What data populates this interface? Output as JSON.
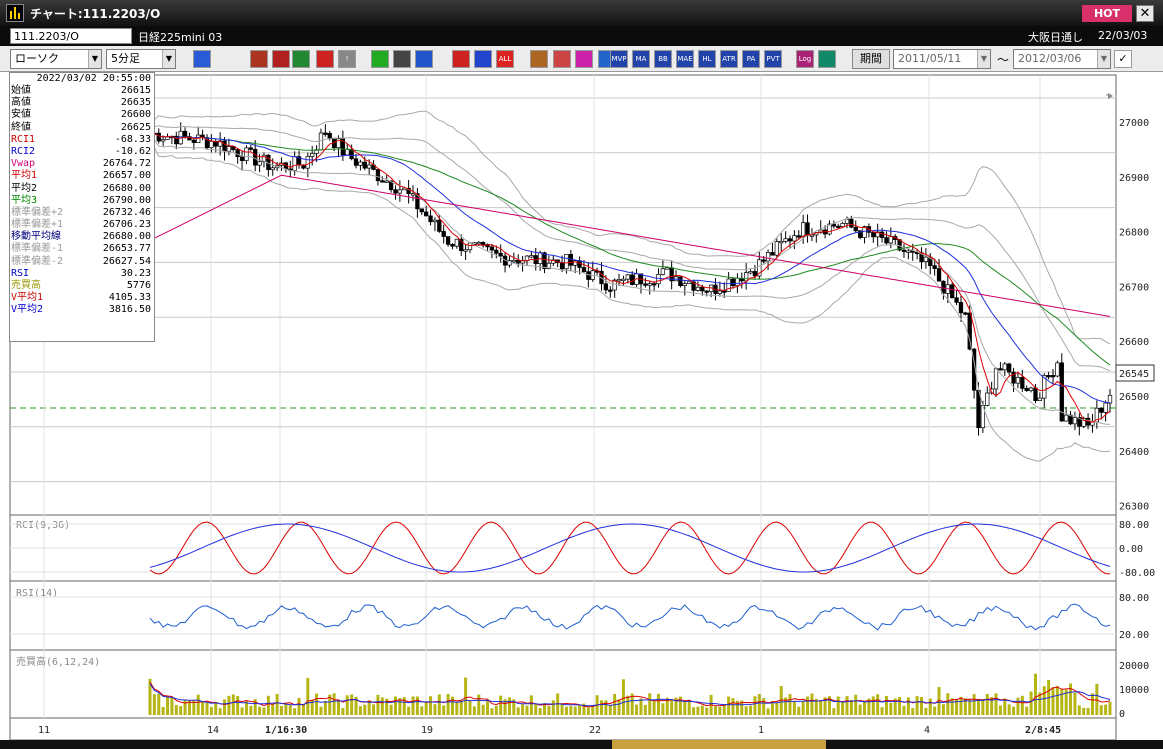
{
  "window": {
    "title": "チャート:111.2203/O",
    "hot_label": "HOT",
    "close_glyph": "✕"
  },
  "symbol_bar": {
    "code": "111.2203/O",
    "name": "日経225mini 03",
    "market": "大阪日通し",
    "date": "22/03/03"
  },
  "toolbar": {
    "chart_type": "ローソク",
    "interval": "5分足",
    "period_label": "期間",
    "date_from": "2011/05/11",
    "date_to": "2012/03/06",
    "tilde": "～",
    "buttons": [
      {
        "name": "zoom-icon",
        "label": "",
        "color": "#2a5bd7"
      },
      {
        "name": "bull-icon",
        "label": "",
        "color": "#aa3322"
      },
      {
        "name": "magnify-icon",
        "label": "",
        "color": "#b02020"
      },
      {
        "name": "bar-chart-icon",
        "label": "",
        "color": "#228833"
      },
      {
        "name": "candle-compare-icon",
        "label": "",
        "color": "#cc2222"
      },
      {
        "name": "warning-icon",
        "label": "!",
        "color": "#888888"
      },
      {
        "name": "pencil-icon",
        "label": "",
        "color": "#22aa22"
      },
      {
        "name": "cursor-icon",
        "label": "",
        "color": "#444444"
      },
      {
        "name": "arrow-icon",
        "label": "",
        "color": "#2255cc"
      },
      {
        "name": "candle-red-icon",
        "label": "",
        "color": "#cc2222"
      },
      {
        "name": "candle-blue-icon",
        "label": "",
        "color": "#2244cc"
      },
      {
        "name": "all-icon",
        "label": "ALL",
        "color": "#dd2222"
      },
      {
        "name": "gear-icon",
        "label": "",
        "color": "#aa6622"
      },
      {
        "name": "wrench-icon",
        "label": "",
        "color": "#cc4444"
      },
      {
        "name": "palette-icon",
        "label": "",
        "color": "#cc22aa"
      },
      {
        "name": "chart-settings-icon",
        "label": "",
        "color": "#2266cc"
      },
      {
        "name": "mvp-icon",
        "label": "MVP",
        "color": "#2244aa"
      },
      {
        "name": "ma-icon",
        "label": "MA",
        "color": "#2244aa"
      },
      {
        "name": "bb-icon",
        "label": "BB",
        "color": "#2244aa"
      },
      {
        "name": "mae-icon",
        "label": "MAE",
        "color": "#2244aa"
      },
      {
        "name": "hl-icon",
        "label": "HL",
        "color": "#2244aa"
      },
      {
        "name": "atr-icon",
        "label": "ATR",
        "color": "#2244aa"
      },
      {
        "name": "para-icon",
        "label": "PA RA",
        "color": "#2244aa"
      },
      {
        "name": "pvt-icon",
        "label": "PVT",
        "color": "#2244aa"
      },
      {
        "name": "log-icon",
        "label": "Log",
        "color": "#aa2277"
      },
      {
        "name": "add-window-icon",
        "label": "",
        "color": "#118866"
      }
    ]
  },
  "data_window": {
    "timestamp": "2022/03/02 20:55:00",
    "rows": [
      {
        "label": "始値",
        "value": "26615",
        "color": "#000000"
      },
      {
        "label": "高値",
        "value": "26635",
        "color": "#000000"
      },
      {
        "label": "安値",
        "value": "26600",
        "color": "#000000"
      },
      {
        "label": "終値",
        "value": "26625",
        "color": "#000000"
      },
      {
        "label": "RCI1",
        "value": "-68.33",
        "color": "#cc0000"
      },
      {
        "label": "RCI2",
        "value": "-10.62",
        "color": "#0000cc"
      },
      {
        "label": "Vwap",
        "value": "26764.72",
        "color": "#cc0077"
      },
      {
        "label": "平均1",
        "value": "26657.00",
        "color": "#cc0000"
      },
      {
        "label": "平均2",
        "value": "26680.00",
        "color": "#000000"
      },
      {
        "label": "平均3",
        "value": "26790.00",
        "color": "#008800"
      },
      {
        "label": "標準偏差+2",
        "value": "26732.46",
        "color": "#999999"
      },
      {
        "label": "標準偏差+1",
        "value": "26706.23",
        "color": "#999999"
      },
      {
        "label": "移動平均線",
        "value": "26680.00",
        "color": "#000080"
      },
      {
        "label": "標準偏差-1",
        "value": "26653.77",
        "color": "#999999"
      },
      {
        "label": "標準偏差-2",
        "value": "26627.54",
        "color": "#999999"
      },
      {
        "label": "RSI",
        "value": "30.23",
        "color": "#0000cc"
      },
      {
        "label": "売買高",
        "value": "5776",
        "color": "#999900"
      },
      {
        "label": "V平均1",
        "value": "4105.33",
        "color": "#cc0000"
      },
      {
        "label": "V平均2",
        "value": "3816.50",
        "color": "#0000cc"
      }
    ]
  },
  "chart": {
    "price_axis_labels": [
      "27000",
      "26900",
      "26800",
      "26700",
      "26600",
      "26500",
      "26400",
      "26300"
    ],
    "current_price": "26545",
    "rci_title": "RCI(9,36)",
    "rci_axis_labels": [
      "80.00",
      "0.00",
      "-80.00"
    ],
    "rsi_title": "RSI(14)",
    "rsi_axis_labels": [
      "80.00",
      "20.00"
    ],
    "volume_title": "売買高(6,12,24)",
    "volume_axis_labels": [
      "20000",
      "10000",
      "0"
    ],
    "time_labels": [
      "11",
      "14",
      "1/16:30",
      "19",
      "22",
      "1",
      "4",
      "2/8:45"
    ],
    "colors": {
      "up_candle": "#ffffff",
      "down_candle": "#000000",
      "ma1": "#dd0000",
      "ma2": "#1f2fdd",
      "ma3": "#1f8a1f",
      "vwap": "#d0006a",
      "bands": "#a8a8a8",
      "rci1": "#dd0000",
      "rci2": "#1f2fdd",
      "rsi": "#1f5fd0",
      "volume": "#b5b514",
      "level_line": "#2a9a2a"
    }
  }
}
